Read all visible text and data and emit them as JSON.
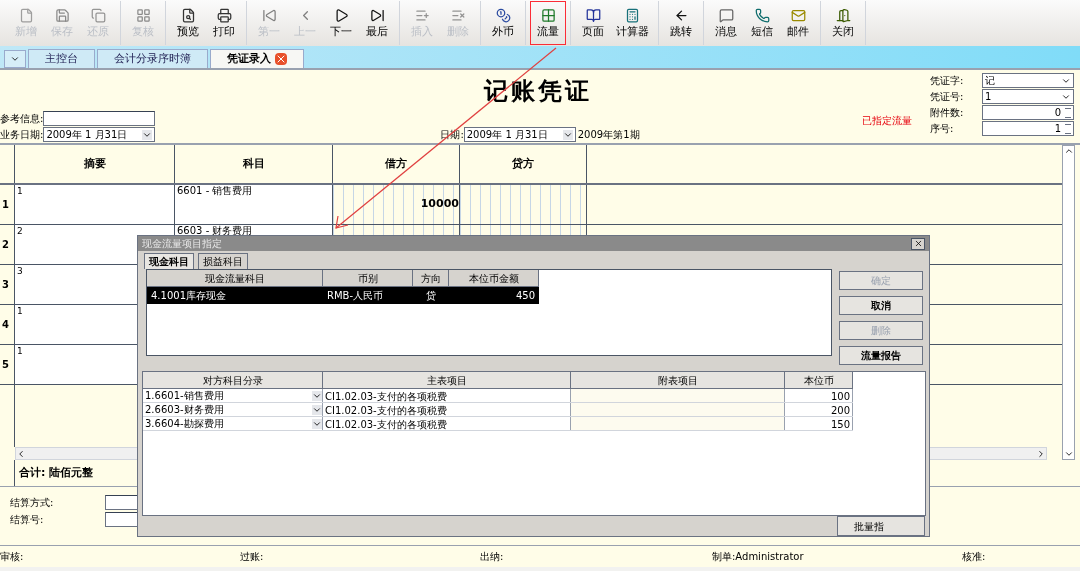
{
  "toolbar_groups": [
    [
      {
        "kind": "new",
        "label": "新增",
        "disabled": true,
        "highlighted": false
      },
      {
        "kind": "save",
        "label": "保存",
        "disabled": true,
        "highlighted": false
      },
      {
        "kind": "restore",
        "label": "还原",
        "disabled": true,
        "highlighted": false
      }
    ],
    [
      {
        "kind": "review",
        "label": "复核",
        "disabled": true,
        "highlighted": false
      }
    ],
    [
      {
        "kind": "preview",
        "label": "预览",
        "disabled": false,
        "highlighted": false
      },
      {
        "kind": "print",
        "label": "打印",
        "disabled": false,
        "highlighted": false
      }
    ],
    [
      {
        "kind": "first",
        "label": "第一",
        "disabled": true,
        "highlighted": false
      },
      {
        "kind": "prev",
        "label": "上一",
        "disabled": true,
        "highlighted": false
      },
      {
        "kind": "next",
        "label": "下一",
        "disabled": false,
        "highlighted": false
      },
      {
        "kind": "last",
        "label": "最后",
        "disabled": false,
        "highlighted": false
      }
    ],
    [
      {
        "kind": "insert",
        "label": "插入",
        "disabled": true,
        "highlighted": false
      },
      {
        "kind": "delete",
        "label": "删除",
        "disabled": true,
        "highlighted": false
      }
    ],
    [
      {
        "kind": "currency",
        "label": "外币",
        "disabled": false,
        "highlighted": false
      }
    ],
    [
      {
        "kind": "flow",
        "label": "流量",
        "disabled": false,
        "highlighted": true
      }
    ],
    [
      {
        "kind": "page",
        "label": "页面",
        "disabled": false,
        "highlighted": false
      },
      {
        "kind": "calculator",
        "label": "计算器",
        "disabled": false,
        "highlighted": false
      }
    ],
    [
      {
        "kind": "jump",
        "label": "跳转",
        "disabled": false,
        "highlighted": false
      }
    ],
    [
      {
        "kind": "message",
        "label": "消息",
        "disabled": false,
        "highlighted": false
      },
      {
        "kind": "sms",
        "label": "短信",
        "disabled": false,
        "highlighted": false
      },
      {
        "kind": "mail",
        "label": "邮件",
        "disabled": false,
        "highlighted": false
      }
    ],
    [
      {
        "kind": "close",
        "label": "关闭",
        "disabled": false,
        "highlighted": false
      }
    ]
  ],
  "tabs": [
    {
      "label": "主控台",
      "selected": false,
      "closable": false
    },
    {
      "label": "会计分录序时簿",
      "selected": false,
      "closable": false
    },
    {
      "label": "凭证录入",
      "selected": true,
      "closable": true
    }
  ],
  "voucher": {
    "title": "记账凭证",
    "reference_label": "参考信息:",
    "business_date_label": "业务日期:",
    "business_date": "2009年 1 月31日",
    "date_label": "日期:",
    "date": "2009年 1 月31日",
    "period": "2009年第1期",
    "flow_status": "已指定流量",
    "fields": [
      {
        "label": "凭证字:",
        "value": "记",
        "kind": "dropdown"
      },
      {
        "label": "凭证号:",
        "value": "1",
        "kind": "dropdown"
      },
      {
        "label": "附件数:",
        "value": "0",
        "kind": "spinner"
      },
      {
        "label": "序号:",
        "value": "1",
        "kind": "spinner"
      }
    ]
  },
  "grid": {
    "columns": [
      "摘要",
      "科目",
      "借方",
      "贷方"
    ],
    "rows": [
      {
        "number": "1",
        "summary": "1",
        "account": "6601 - 销售费用",
        "debit": "10000"
      },
      {
        "number": "2",
        "summary": "2",
        "account": "6603 - 财务费用"
      },
      {
        "number": "3",
        "summary": "3"
      },
      {
        "number": "4",
        "summary": "1"
      },
      {
        "number": "5",
        "summary": "1"
      }
    ],
    "total": "合计: 陆佰元整"
  },
  "settlement": {
    "method_label": "结算方式:",
    "number_label": "结算号:"
  },
  "status_bar": [
    "审核:",
    "过账:",
    "出纳:",
    "制单:Administrator",
    "核准:"
  ],
  "dialog": {
    "title": "现金流量项目指定",
    "tabs": [
      {
        "label": "现金科目",
        "selected": true
      },
      {
        "label": "损益科目",
        "selected": false
      }
    ],
    "cash_columns": [
      "现金流量科目",
      "币别",
      "方向",
      "本位币金额"
    ],
    "cash_rows": [
      {
        "account": "4.1001库存现金",
        "currency": "RMB-人民币",
        "direction": "贷",
        "amount": "450",
        "selected": true
      }
    ],
    "buttons": [
      {
        "label": "确定",
        "disabled": true
      },
      {
        "label": "取消",
        "disabled": false
      },
      {
        "label": "删除",
        "disabled": true
      },
      {
        "label": "流量报告",
        "disabled": false
      }
    ],
    "entry_columns": [
      "对方科目分录",
      "主表项目",
      "附表项目",
      "本位币"
    ],
    "entry_rows": [
      {
        "entry": "1.6601-销售费用",
        "main_item": "CI1.02.03-支付的各项税费",
        "amount": "100"
      },
      {
        "entry": "2.6603-财务费用",
        "main_item": "CI1.02.03-支付的各项税费",
        "amount": "200"
      },
      {
        "entry": "3.6604-勘探费用",
        "main_item": "CI1.02.03-支付的各项税费",
        "amount": "150"
      }
    ],
    "batch_button": "批量指"
  }
}
